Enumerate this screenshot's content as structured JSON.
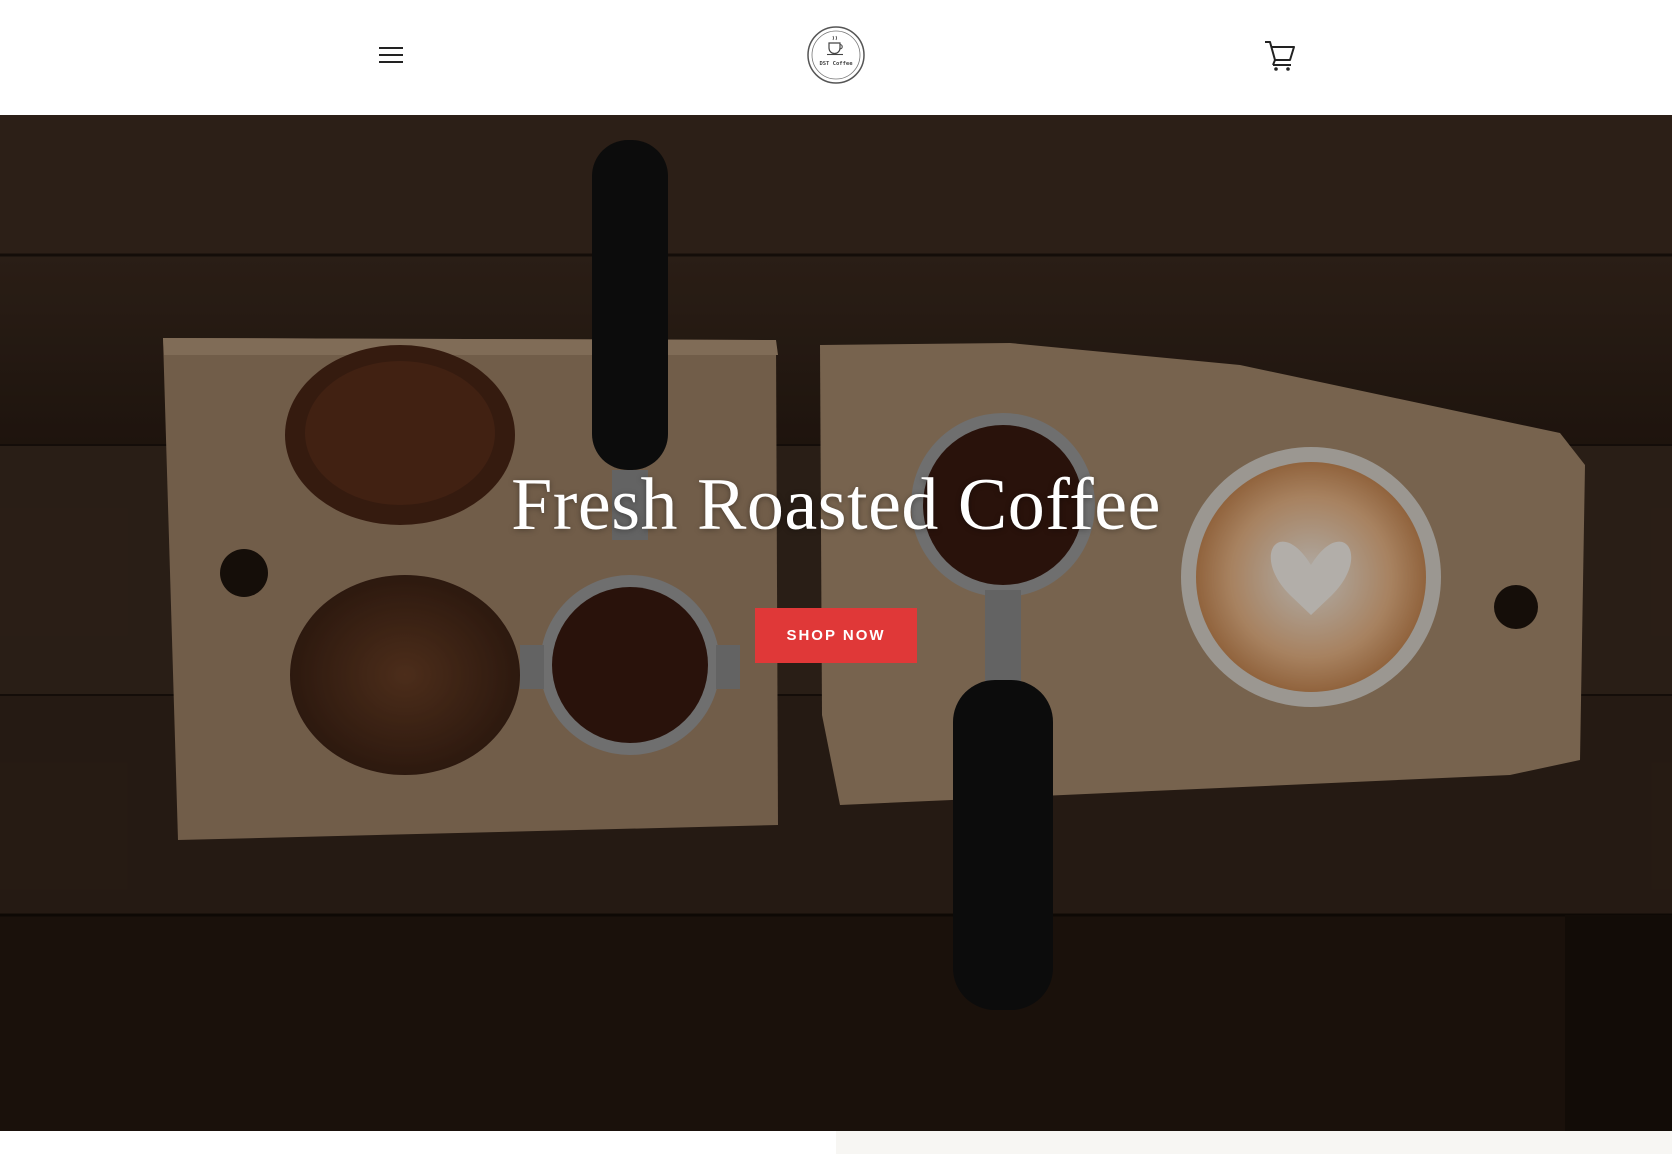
{
  "header": {
    "menu_label": "Menu",
    "logo": {
      "text": "DST Coffee",
      "icon": "coffee-cup-icon"
    },
    "cart_label": "Cart"
  },
  "hero": {
    "title": "Fresh Roasted Coffee",
    "cta_label": "SHOP NOW",
    "cta_color": "#e03838"
  },
  "icons": {
    "menu": "hamburger-menu-icon",
    "cart": "shopping-cart-icon"
  }
}
